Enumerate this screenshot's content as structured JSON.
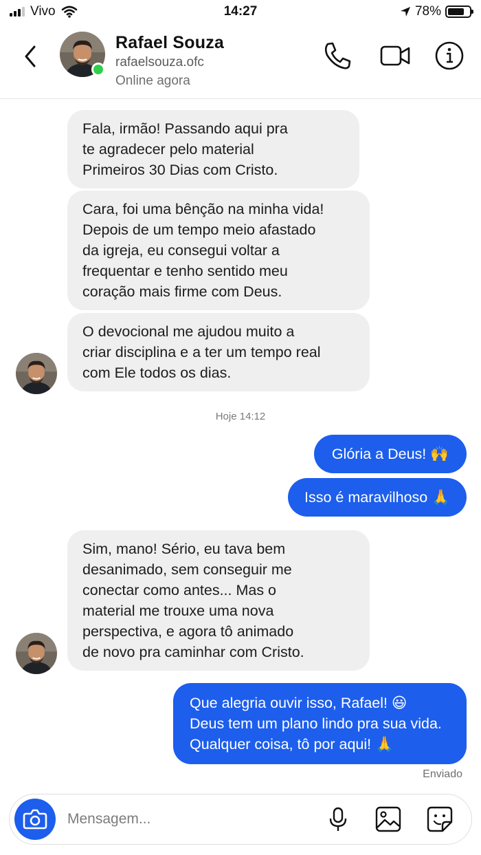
{
  "status_bar": {
    "carrier": "Vivo",
    "time": "14:27",
    "battery_percent": "78%",
    "battery_level": 0.78
  },
  "header": {
    "name": "Rafael Souza",
    "username": "rafaelsouza.ofc",
    "status": "Online agora"
  },
  "messages": {
    "m1": "Fala, irmão! Passando aqui pra\nte agradecer pelo material\nPrimeiros 30 Dias com Cristo.",
    "m2": "Cara, foi uma bênção na minha vida!\nDepois de um tempo meio afastado\nda igreja, eu consegui voltar a\nfrequentar e tenho sentido meu\ncoração mais firme com Deus.",
    "m3": "O devocional me ajudou muito a\ncriar disciplina e a ter um tempo real\ncom Ele todos os dias.",
    "timestamp": "Hoje 14:12",
    "m4": "Glória a Deus! 🙌",
    "m5": "Isso é maravilhoso 🙏",
    "m6": "Sim, mano! Sério, eu tava bem\ndesanimado, sem conseguir me\nconectar como antes... Mas o\nmaterial me trouxe uma nova\nperspectiva, e agora tô animado\nde novo pra caminhar com Cristo.",
    "m7": "Que alegria ouvir isso, Rafael! 😃\nDeus tem um plano lindo pra sua vida.\nQualquer coisa, tô por aqui! 🙏",
    "sent_label": "Enviado"
  },
  "composer": {
    "placeholder": "Mensagem..."
  },
  "colors": {
    "accent": "#1d5eec",
    "incoming_bubble": "#efefef",
    "online": "#2fcf4a"
  },
  "icons": [
    "back-icon",
    "phone-icon",
    "video-camera-icon",
    "info-icon",
    "camera-icon",
    "microphone-icon",
    "image-icon",
    "sticker-icon",
    "location-arrow-icon",
    "wifi-icon",
    "signal-icon",
    "battery-icon"
  ]
}
